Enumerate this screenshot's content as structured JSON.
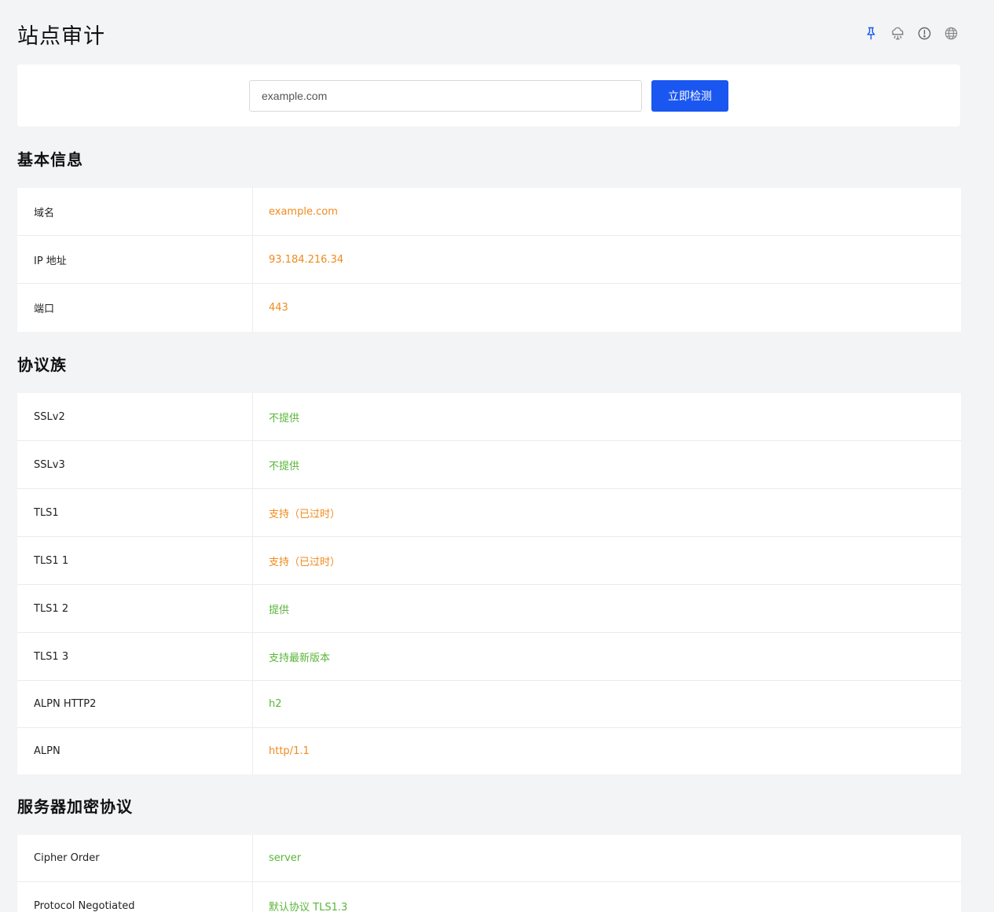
{
  "header": {
    "title": "站点审计",
    "icons": [
      "pin-icon",
      "cloud-icon",
      "info-icon",
      "globe-icon"
    ],
    "accent_color": "#1a56f0"
  },
  "search": {
    "placeholder": "example.com",
    "value": "",
    "button_label": "立即检测"
  },
  "sections": {
    "basic": {
      "title": "基本信息",
      "rows": [
        {
          "label": "域名",
          "value": "example.com",
          "status": "orange"
        },
        {
          "label": "IP 地址",
          "value": "93.184.216.34",
          "status": "orange"
        },
        {
          "label": "端口",
          "value": "443",
          "status": "orange"
        }
      ]
    },
    "protocols": {
      "title": "协议族",
      "rows": [
        {
          "label": "SSLv2",
          "value": "不提供",
          "status": "green"
        },
        {
          "label": "SSLv3",
          "value": "不提供",
          "status": "green"
        },
        {
          "label": "TLS1",
          "value": "支持（已过时）",
          "status": "orange"
        },
        {
          "label": "TLS1 1",
          "value": "支持（已过时）",
          "status": "orange"
        },
        {
          "label": "TLS1 2",
          "value": "提供",
          "status": "green"
        },
        {
          "label": "TLS1 3",
          "value": "支持最新版本",
          "status": "green"
        },
        {
          "label": "ALPN HTTP2",
          "value": "h2",
          "status": "green"
        },
        {
          "label": "ALPN",
          "value": "http/1.1",
          "status": "orange"
        }
      ]
    },
    "ciphers": {
      "title": "服务器加密协议",
      "rows": [
        {
          "label": "Cipher Order",
          "value": "server",
          "status": "green"
        },
        {
          "label": "Protocol Negotiated",
          "value": "默认协议 TLS1.3",
          "status": "green"
        }
      ]
    }
  },
  "colors": {
    "orange": "#f08a1c",
    "green": "#5ab63a"
  }
}
